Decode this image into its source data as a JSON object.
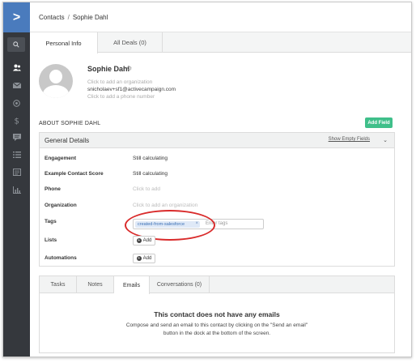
{
  "breadcrumb": {
    "root": "Contacts",
    "separator": "/",
    "current": "Sophie Dahl"
  },
  "sidebar": {
    "logo_glyph": ">",
    "icons": [
      "search-icon",
      "contacts-icon",
      "mail-icon",
      "target-icon",
      "dollar-icon",
      "chat-icon",
      "list-icon",
      "document-icon",
      "reports-icon"
    ]
  },
  "profile_tabs": [
    "Personal Info",
    "All Deals (0)"
  ],
  "contact": {
    "name": "Sophie Dahl",
    "settings_glyph": "⚙",
    "organization_placeholder": "Click to add an organization",
    "email": "snicholaev+sf1@activecampaign.com",
    "phone_placeholder": "Click to add a phone number"
  },
  "about": {
    "title": "ABOUT SOPHIE DAHL",
    "add_field_label": "Add Field"
  },
  "general_details": {
    "title": "General Details",
    "show_empty_fields": "Show Empty Fields",
    "chevron": "⌄",
    "rows": {
      "engagement": {
        "label": "Engagement",
        "value": "Still calculating"
      },
      "example_score": {
        "label": "Example Contact Score",
        "value": "Still calculating"
      },
      "phone": {
        "label": "Phone",
        "value": "Click to add"
      },
      "organization": {
        "label": "Organization",
        "value": "Click to add an organization"
      },
      "tags": {
        "label": "Tags",
        "tag": "created-from-salesforce",
        "remove": "×",
        "placeholder": "Enter tags"
      },
      "lists": {
        "label": "Lists",
        "button": "Add"
      },
      "automations": {
        "label": "Automations",
        "button": "Add"
      }
    }
  },
  "activity_tabs": [
    "Tasks",
    "Notes",
    "Emails",
    "Conversations (0)"
  ],
  "empty_state": {
    "title": "This contact does not have any emails",
    "description": "Compose and send an email to this contact by clicking on the \"Send an email\" button in the dock at the bottom of the screen."
  },
  "colors": {
    "accent_blue": "#4a7bbd",
    "add_green": "#3fbf8a",
    "highlight_red": "#d92b2b",
    "sidebar_dark": "#35383d"
  }
}
